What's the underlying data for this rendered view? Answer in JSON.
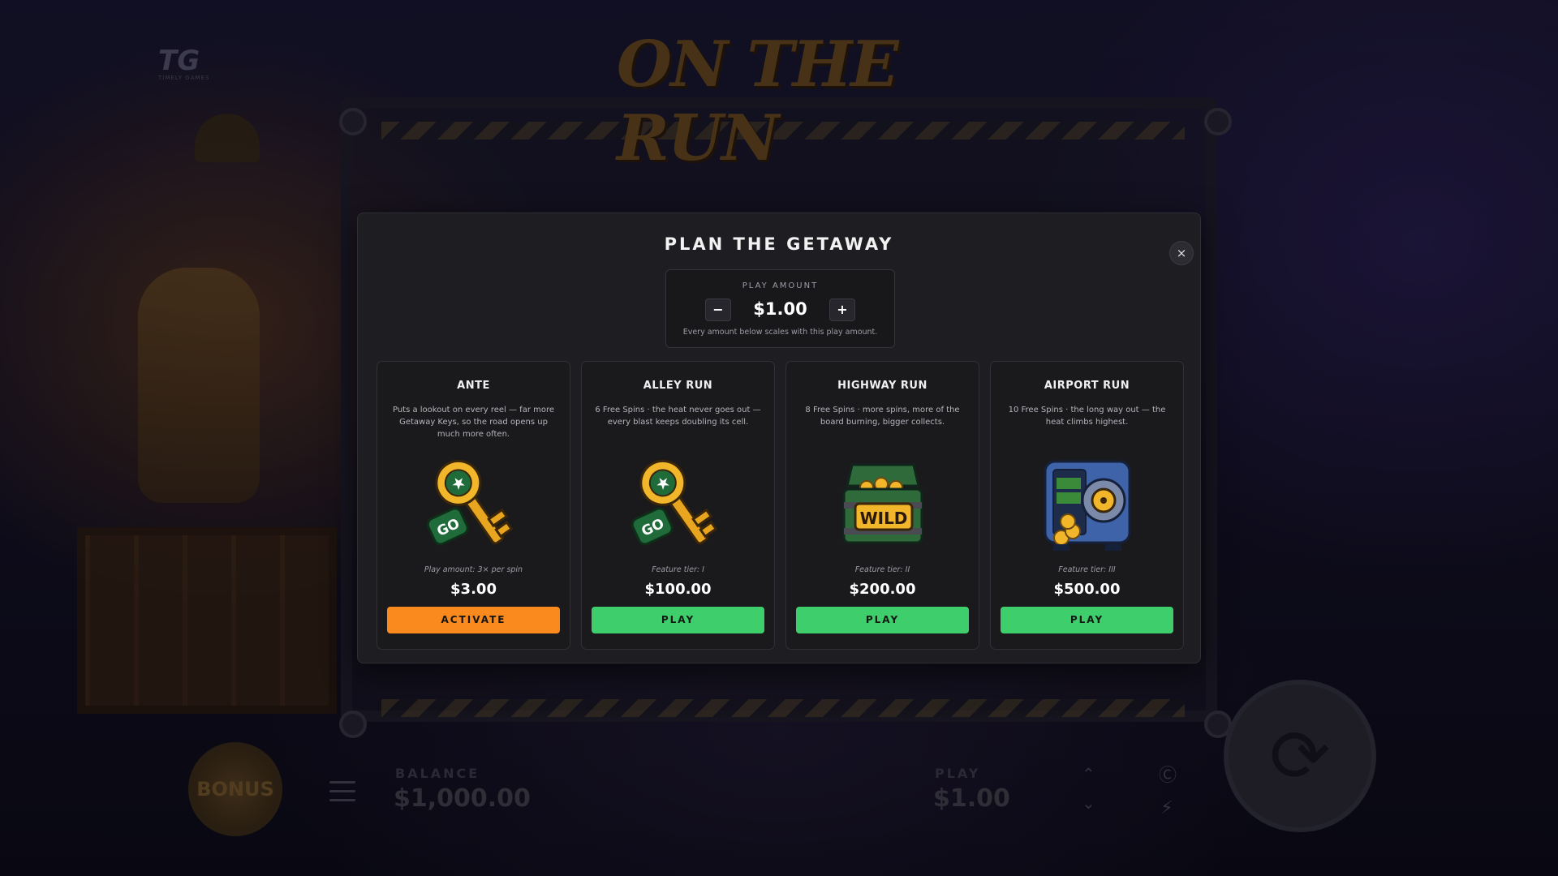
{
  "background": {
    "brand": "TG",
    "brand_sub": "TIMELY GAMES",
    "game_title": "ON THE RUN",
    "bonus_label": "BONUS",
    "balance_label": "BALANCE",
    "balance_value": "$1,000.00",
    "play_label": "PLAY",
    "play_value": "$1.00",
    "icons": {
      "menu": "hamburger-menu-icon",
      "up": "chevron-up-icon",
      "down": "chevron-down-icon",
      "auto": "autoplay-icon",
      "turbo": "lightning-icon",
      "spin": "spin-arrows-icon"
    }
  },
  "modal": {
    "title": "PLAN THE GETAWAY",
    "close_glyph": "×",
    "play_amount": {
      "label": "PLAY AMOUNT",
      "minus": "−",
      "plus": "+",
      "value": "$1.00",
      "note": "Every amount below scales with this play amount."
    },
    "cards": [
      {
        "title": "ANTE",
        "description": "Puts a lookout on every reel — far more Getaway Keys, so the road opens up much more often.",
        "art": "getaway-key-icon",
        "tier": "Play amount: 3× per spin",
        "price": "$3.00",
        "button": "ACTIVATE"
      },
      {
        "title": "ALLEY RUN",
        "description": "6 Free Spins · the heat never goes out — every blast keeps doubling its cell.",
        "art": "getaway-key-icon",
        "tier": "Feature tier: I",
        "price": "$100.00",
        "button": "PLAY"
      },
      {
        "title": "HIGHWAY RUN",
        "description": "8 Free Spins · more spins, more of the board burning, bigger collects.",
        "art": "wild-chest-icon",
        "art_text": "WILD",
        "tier": "Feature tier: II",
        "price": "$200.00",
        "button": "PLAY"
      },
      {
        "title": "AIRPORT RUN",
        "description": "10 Free Spins · the long way out — the heat climbs highest.",
        "art": "vault-safe-icon",
        "tier": "Feature tier: III",
        "price": "$500.00",
        "button": "PLAY"
      }
    ]
  },
  "colors": {
    "modal_bg": "#1e1e22",
    "activate_button": "#fb8a1e",
    "play_button": "#3ecf6c",
    "key_gold": "#f2b62b",
    "tag_green": "#1f6b3a"
  }
}
